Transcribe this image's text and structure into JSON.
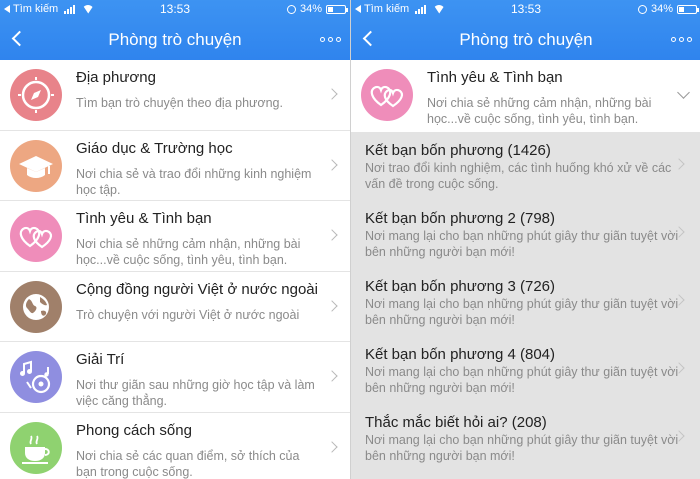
{
  "colors": {
    "header": "#2f84ee",
    "accent_text": "#ffffff"
  },
  "status_bar": {
    "carrier": "Tìm kiếm",
    "time": "13:53",
    "battery": "34%",
    "battery_fraction": 0.34
  },
  "header": {
    "title": "Phòng trò chuyện",
    "back_icon": "chevron-left-icon",
    "more_icon": "more-dots-icon"
  },
  "left": {
    "items": [
      {
        "title": "Địa phương",
        "desc": "Tìm bạn trò chuyện theo địa phương.",
        "icon": "compass-icon",
        "color": "#e8838a"
      },
      {
        "title": "Giáo dục & Trường học",
        "desc": "Nơi chia sẻ và trao đổi những kinh nghiệm học tập.",
        "icon": "graduation-cap-icon",
        "color": "#eda782"
      },
      {
        "title": "Tình yêu & Tình bạn",
        "desc": "Nơi chia sẻ những cảm nhận, những bài học...về cuộc sống, tình yêu, tình bạn.",
        "icon": "hearts-icon",
        "color": "#ef8dba"
      },
      {
        "title": "Cộng đồng người Việt ở nước ngoài",
        "desc": "Trò chuyện với người Việt ở nước ngoài",
        "icon": "globe-icon",
        "color": "#a0806a"
      },
      {
        "title": "Giải Trí",
        "desc": "Nơi thư giãn sau những giờ học tập và làm việc căng thẳng.",
        "icon": "music-notes-icon",
        "color": "#8f8ee0"
      },
      {
        "title": "Phong cách sống",
        "desc": "Nơi chia sẻ các quan điểm, sở thích của bạn trong cuộc sống.",
        "icon": "coffee-cup-icon",
        "color": "#8fd270"
      }
    ]
  },
  "right": {
    "selected": {
      "title": "Tình yêu & Tình bạn",
      "desc": "Nơi chia sẻ những cảm nhận, những bài học...về cuộc sống, tình yêu, tình bạn.",
      "icon": "hearts-icon",
      "color": "#ef8dba"
    },
    "groups": [
      {
        "title": "Kết bạn bốn phương (1426)",
        "desc": "Nơi trao đổi kinh nghiệm, các tình huống khó xử về các vấn đề trong cuộc sống."
      },
      {
        "title": "Kết bạn bốn phương 2 (798)",
        "desc": "Nơi mang lại cho bạn những phút giây thư giãn tuyệt vời bên những người bạn mới!"
      },
      {
        "title": "Kết bạn bốn phương 3 (726)",
        "desc": "Nơi mang lại cho bạn những phút giây thư giãn tuyệt vời bên những người bạn mới!"
      },
      {
        "title": "Kết bạn bốn phương 4 (804)",
        "desc": "Nơi mang lại cho bạn những phút giây thư giãn tuyệt vời bên những người bạn mới!"
      },
      {
        "title": "Thắc mắc biết hỏi ai? (208)",
        "desc": "Nơi mang lại cho bạn những phút giây thư giãn tuyệt vời bên những người bạn mới!"
      }
    ]
  }
}
